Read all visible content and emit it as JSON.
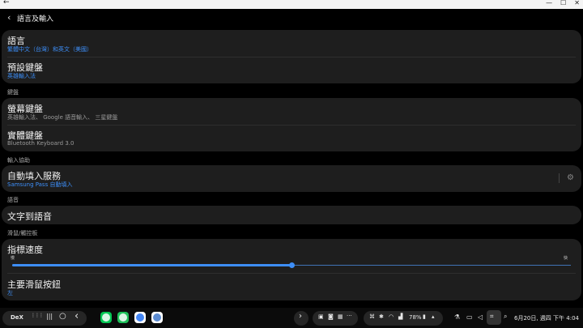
{
  "window": {
    "back_glyph": "←",
    "minimize_glyph": "—",
    "maximize_glyph": "☐",
    "close_glyph": "✕"
  },
  "header": {
    "back_glyph": "‹",
    "title": "語言及輸入"
  },
  "language_card": {
    "language": {
      "title": "語言",
      "subtitle": "繁體中文（台灣）和英文（美國）"
    },
    "default_keyboard": {
      "title": "預設鍵盤",
      "subtitle": "英雄輸入法"
    }
  },
  "sections": {
    "keyboard": "鍵盤",
    "input_assist": "輸入協助",
    "speech": "語音",
    "mouse": "滑鼠/觸控板"
  },
  "keyboard_card": {
    "onscreen": {
      "title": "螢幕鍵盤",
      "subtitle": "英雄輸入法、 Google 語音輸入、 三星鍵盤"
    },
    "physical": {
      "title": "實體鍵盤",
      "subtitle": "Bluetooth Keyboard 3.0"
    }
  },
  "autofill_card": {
    "title": "自動填入服務",
    "subtitle": "Samsung Pass 自動填入",
    "gear_glyph": "⚙"
  },
  "tts_card": {
    "title": "文字到語音"
  },
  "mouse_card": {
    "pointer_speed": {
      "title": "指標速度",
      "slow_label": "慢",
      "fast_label": "快",
      "level": 0.5
    },
    "primary_button": {
      "title": "主要滑鼠按鈕",
      "value": "左"
    }
  },
  "taskbar": {
    "dex_label": "DeX",
    "apps_glyph": "⋮⋮⋮",
    "recents_glyph": "|||",
    "home_glyph": "○",
    "back_glyph": "‹",
    "expand_glyph": "›",
    "more_glyph": "···",
    "battery": "78%",
    "caret_glyph": "▴",
    "datetime": "6月20日, 週四 下午 4:04",
    "colors": {
      "line": "#06c755",
      "phone": "#1fbf5a",
      "chrome": "#4285f4",
      "camera": "#5b8bd1"
    }
  }
}
